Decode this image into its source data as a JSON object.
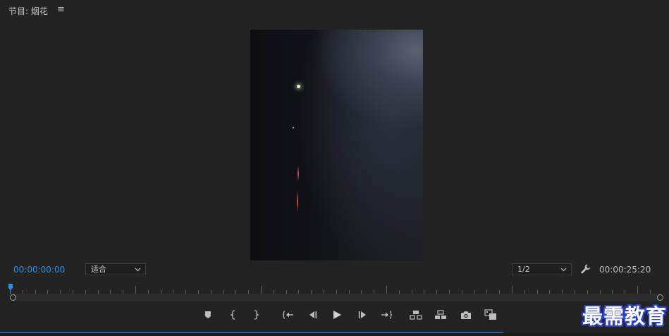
{
  "panel": {
    "title": "节目: 烟花",
    "menu_glyph": "≡"
  },
  "monitor": {
    "current_timecode": "00:00:00:00",
    "duration_timecode": "00:00:25:20",
    "zoom_select": {
      "value": "适合"
    },
    "resolution_select": {
      "value": "1/2"
    },
    "playhead_position_percent": 0
  },
  "transport": {
    "buttons": [
      {
        "name": "add-marker-button",
        "icon": "marker-icon"
      },
      {
        "name": "mark-in-button",
        "icon": "mark-in-icon"
      },
      {
        "name": "mark-out-button",
        "icon": "mark-out-icon"
      },
      {
        "name": "go-to-in-button",
        "icon": "go-to-in-icon"
      },
      {
        "name": "step-back-button",
        "icon": "step-back-icon"
      },
      {
        "name": "play-button",
        "icon": "play-icon"
      },
      {
        "name": "step-forward-button",
        "icon": "step-forward-icon"
      },
      {
        "name": "go-to-out-button",
        "icon": "go-to-out-icon"
      },
      {
        "name": "lift-button",
        "icon": "lift-icon"
      },
      {
        "name": "extract-button",
        "icon": "extract-icon"
      },
      {
        "name": "export-frame-button",
        "icon": "camera-icon"
      },
      {
        "name": "comparison-view-button",
        "icon": "comparison-icon"
      }
    ]
  },
  "watermark": "最需教育",
  "colors": {
    "background": "#232323",
    "accent_blue": "#2f8ee5",
    "watermark_outline": "#2a3fd0"
  }
}
